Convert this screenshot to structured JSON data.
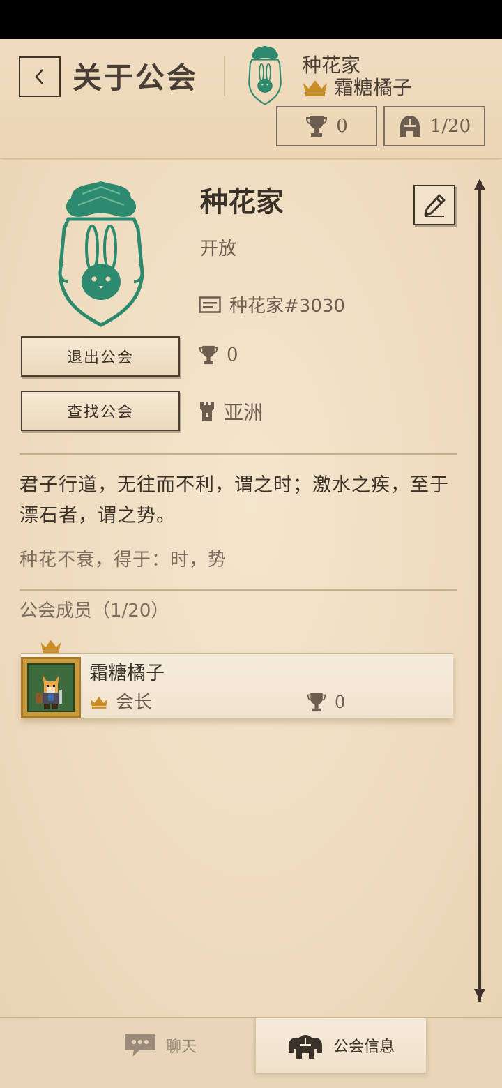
{
  "header": {
    "title": "关于公会",
    "guild_name": "种花家",
    "leader_name": "霜糖橘子",
    "trophy_count": "0",
    "member_count": "1/20"
  },
  "guild": {
    "name": "种花家",
    "status": "开放",
    "id_label": "种花家#3030",
    "trophies": "0",
    "region": "亚洲",
    "leave_label": "退出公会",
    "find_label": "查找公会",
    "motto": "君子行道，无往而不利，谓之时；激水之疾，至于漂石者，谓之势。",
    "motto_sub": "种花不衰，得于：时，势"
  },
  "members": {
    "heading": "公会成员（1/20）",
    "list": [
      {
        "name": "霜糖橘子",
        "role": "会长",
        "trophies": "0"
      }
    ]
  },
  "tabs": {
    "chat": "聊天",
    "guild_info": "公会信息"
  },
  "colors": {
    "parchment": "#efdcbf",
    "ink": "#3a3129",
    "muted_ink": "#6b5d50",
    "emblem_green": "#2e8a6e",
    "gold": "#c98d28"
  },
  "icons": [
    "back-arrow-icon",
    "bunny-emblem-icon",
    "crown-icon",
    "trophy-icon",
    "knight-helmet-icon",
    "edit-pencil-icon",
    "id-card-icon",
    "tower-icon",
    "chat-bubble-icon",
    "helmets-group-icon"
  ]
}
